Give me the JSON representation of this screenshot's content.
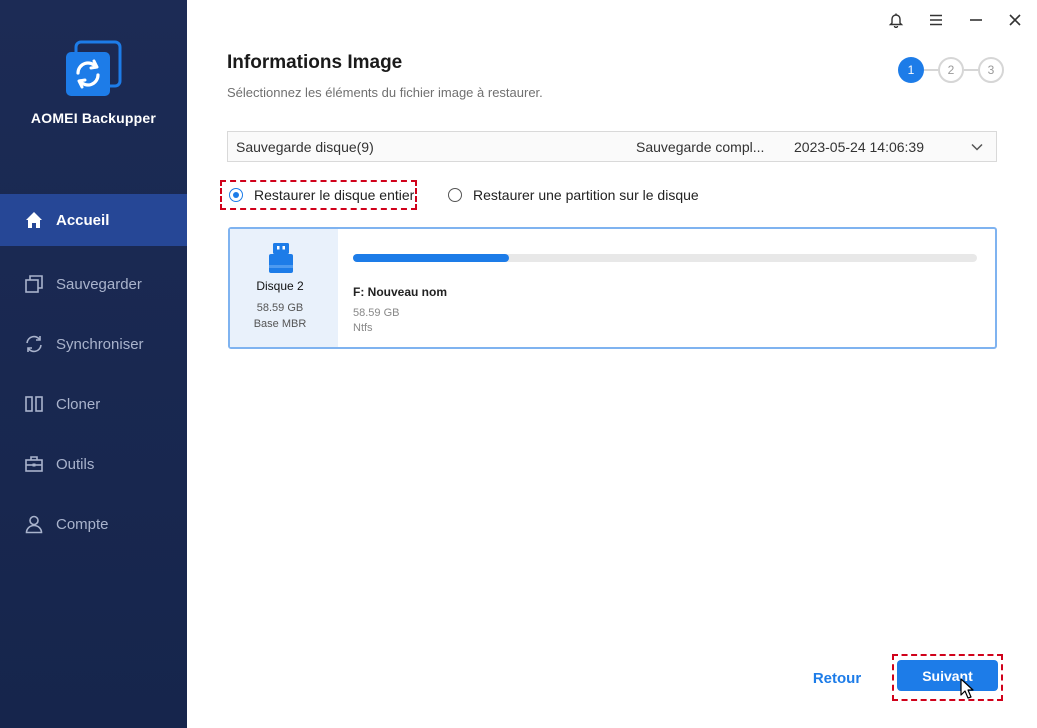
{
  "app": {
    "name": "AOMEI Backupper"
  },
  "sidebar": {
    "items": [
      {
        "label": "Accueil",
        "icon": "home-icon",
        "active": true
      },
      {
        "label": "Sauvegarder",
        "icon": "backup-icon",
        "active": false
      },
      {
        "label": "Synchroniser",
        "icon": "sync-icon",
        "active": false
      },
      {
        "label": "Cloner",
        "icon": "clone-icon",
        "active": false
      },
      {
        "label": "Outils",
        "icon": "toolbox-icon",
        "active": false
      },
      {
        "label": "Compte",
        "icon": "user-icon",
        "active": false
      }
    ]
  },
  "window_controls": [
    "bell-icon",
    "menu-icon",
    "minimize-icon",
    "close-icon"
  ],
  "main": {
    "title": "Informations Image",
    "subtitle": "Sélectionnez les éléments du fichier image à restaurer.",
    "steps": [
      "1",
      "2",
      "3"
    ],
    "current_step": 1,
    "image_select": {
      "name": "Sauvegarde disque(9)",
      "type": "Sauvegarde compl...",
      "date": "2023-05-24 14:06:39"
    },
    "restore_options": [
      {
        "label": "Restaurer le disque entier",
        "checked": true
      },
      {
        "label": "Restaurer une partition sur le disque",
        "checked": false
      }
    ],
    "disk": {
      "name": "Disque 2",
      "size": "58.59 GB",
      "type": "Base MBR",
      "partition": {
        "name": "F: Nouveau nom",
        "size": "58.59 GB",
        "fs": "Ntfs",
        "used_fraction": 0.25
      }
    },
    "buttons": {
      "back": "Retour",
      "next": "Suivant"
    }
  },
  "colors": {
    "accent": "#1d7ce8",
    "sidebar_bg": "#1c2b55",
    "sidebar_active": "#264796",
    "highlight": "#d0021b"
  }
}
